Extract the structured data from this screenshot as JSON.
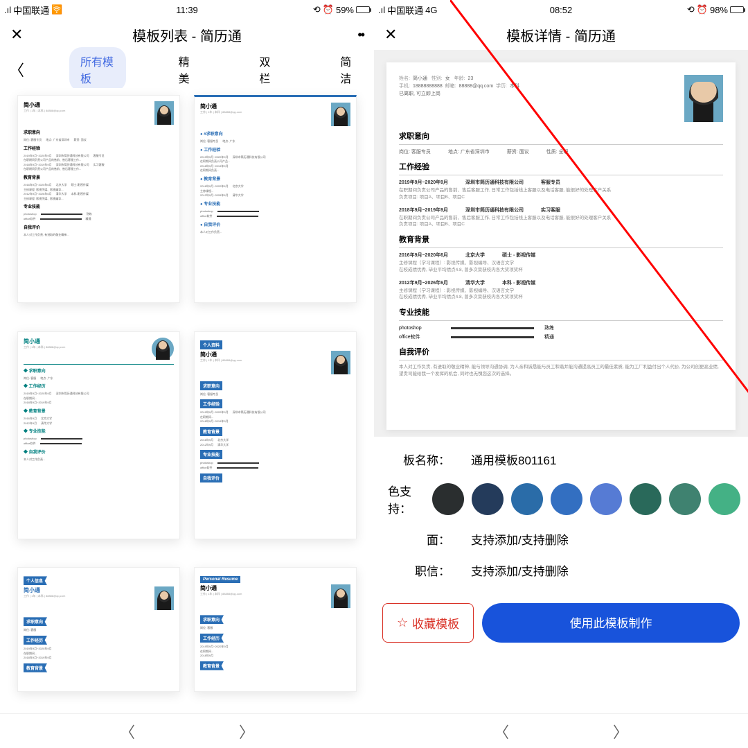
{
  "left_screen": {
    "status_bar": {
      "carrier": "中国联通",
      "time": "11:39",
      "battery_pct": "59%",
      "battery_level": 59
    },
    "nav": {
      "title": "模板列表 - 简历通"
    },
    "tabs": {
      "t0": "所有模板",
      "t1": "精美",
      "t2": "双栏",
      "t3": "简洁"
    },
    "thumb_name": "简小通",
    "thumb_sub": "工作 | 1年 | 本科 | 88888@qq.com",
    "sections": {
      "intent": "求职意向",
      "intent2": "#求职意向",
      "work": "工作经验",
      "work2": "工作经历",
      "edu": "教育背景",
      "skill": "专业技能",
      "self": "自我评价",
      "self2": "自我评价"
    },
    "line_date": "2019年9月~2020年9月",
    "line_company": "深圳市简历通科技有限公司",
    "line_role": "客服专员",
    "line_intern": "实习客服"
  },
  "right_screen": {
    "status_bar": {
      "carrier": "中国联通",
      "network": "4G",
      "time": "08:52",
      "battery_pct": "98%",
      "battery_level": 98
    },
    "nav": {
      "title": "模板详情 - 简历通"
    },
    "resume": {
      "name_lbl": "姓名:",
      "name": "简小通",
      "gender_lbl": "性别:",
      "gender": "女",
      "age_lbl": "年龄:",
      "age": "23",
      "phone_lbl": "手机:",
      "phone": "18888888888",
      "email_lbl": "邮箱:",
      "email": "88888@qq.com",
      "degree_lbl": "学历:",
      "degree": "本科",
      "status_lbl": "已离职, 可立即上岗",
      "sec_intent": "求职意向",
      "intent_pos_lbl": "岗位:",
      "intent_pos": "客服专员",
      "intent_loc_lbl": "地点:",
      "intent_loc": "广东省深圳市",
      "intent_sal_lbl": "薪资:",
      "intent_sal": "面议",
      "intent_type_lbl": "性质:",
      "intent_type": "全职",
      "sec_work": "工作经验",
      "w1_date": "2019年9月~2020年9月",
      "w1_co": "深圳市简历通科技有限公司",
      "w1_role": "客服专员",
      "w1_desc": "在职期间负责公司产品的售前、售后客服工作, 日常工作包括线上客服以及电话客服, 能很好的处理客户关系",
      "w1_proj": "负责项目: 项目A、项目B、项目C",
      "w2_date": "2018年9月~2019年9月",
      "w2_co": "深圳市简历通科技有限公司",
      "w2_role": "实习客服",
      "w2_desc": "在职期间负责公司产品的售前、售后客服工作, 日常工作包括线上客服以及电话客服, 能很好的处理客户关系",
      "w2_proj": "负责项目: 项目A、项目B、项目C",
      "sec_edu": "教育背景",
      "e1_date": "2016年9月~2020年6月",
      "e1_school": "北京大学",
      "e1_deg": "硕士 - 影视传媒",
      "e1_courses": "主修课程（学习课程）: 影视传媒、影视编导、汉语言文学",
      "e1_honor": "在校成绩优秀, 毕业平均绩点4.8, 曾多次荣获校内各大奖项奖杯",
      "e2_date": "2012年9月~2026年6月",
      "e2_school": "清华大学",
      "e2_deg": "本科 - 影视传媒",
      "e2_courses": "主修课程（学习课程）: 影视传媒、影视编导、汉语言文学",
      "e2_honor": "在校成绩优秀, 毕业平均绩点4.8, 曾多次荣获校内各大奖项奖杯",
      "sec_skill": "专业技能",
      "sk1": "photoshop",
      "sk1_lvl": "熟练",
      "sk2": "office软件",
      "sk2_lvl": "精通",
      "sec_self": "自我评价",
      "self_text": "本人对工作负责, 有进取的敬业精神, 能与领导沟通协调, 为人亲和诚恳能与员工和谐并能沟通提高员工的最佳素质, 能为工厂利益付出个人代价, 为公司创更高业绩, 望贵司能给我一个发挥的机会, 同时也无愧您这次的选择。"
    },
    "attrs": {
      "name_lbl": "板名称：",
      "name_val": "通用模板801161",
      "color_lbl": "色支持：",
      "cover_lbl": "面：",
      "cover_val": "支持添加/支持删除",
      "letter_lbl": "职信：",
      "letter_val": "支持添加/支持删除"
    },
    "colors": {
      "c0": "#2a2e2f",
      "c1": "#243b5b",
      "c2": "#2a6ca8",
      "c3": "#336fc1",
      "c4": "#567bd4",
      "c5": "#29695a",
      "c6": "#3f8270",
      "c7": "#44b185"
    },
    "actions": {
      "fav": "收藏模板",
      "use": "使用此模板制作"
    }
  }
}
